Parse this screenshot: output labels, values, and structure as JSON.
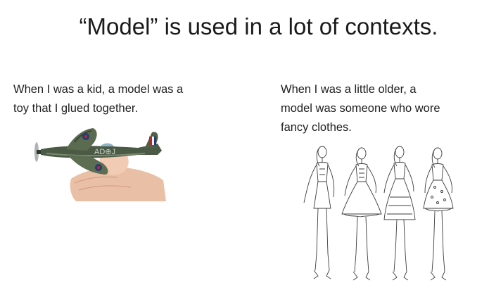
{
  "slide": {
    "title": "“Model” is used in a lot of contexts.",
    "left_column": {
      "caption_lines": [
        "When I was a kid, a model was a",
        "toy that I glued together."
      ],
      "image_label": "AD⊕J"
    },
    "right_column": {
      "caption_lines": [
        "When I was a little older, a",
        "model was someone who wore",
        "fancy clothes."
      ]
    }
  }
}
